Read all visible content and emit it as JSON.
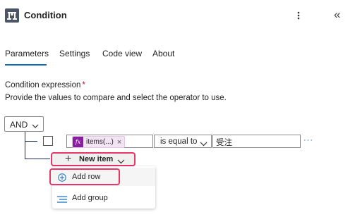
{
  "header": {
    "title": "Condition",
    "icon": "condition-icon",
    "more_icon": "more-vertical-icon",
    "collapse_icon": "collapse-double-chevron-icon",
    "collapse_glyph": "«"
  },
  "tabs": [
    {
      "label": "Parameters",
      "active": true
    },
    {
      "label": "Settings",
      "active": false
    },
    {
      "label": "Code view",
      "active": false
    },
    {
      "label": "About",
      "active": false
    }
  ],
  "condition": {
    "label": "Condition expression",
    "required_mark": "*",
    "help_text": "Provide the values to compare and select the operator to use.",
    "group_operator": "AND",
    "row": {
      "left_token": "items(...)",
      "left_token_icon": "fx",
      "left_token_remove": "×",
      "operator": "is equal to",
      "right_value": "受注",
      "more_glyph": "···"
    },
    "new_item_button": {
      "label": "New item",
      "plus": "+"
    },
    "menu": [
      {
        "label": "Add row",
        "icon": "add-circle-icon",
        "highlighted": true
      },
      {
        "label": "Add group",
        "icon": "add-group-icon",
        "highlighted": false
      }
    ]
  },
  "colors": {
    "accent": "#0f6cbd",
    "highlight": "#e8366b",
    "token_bg": "#f3e3f4",
    "fx_bg": "#8a1ca0"
  }
}
